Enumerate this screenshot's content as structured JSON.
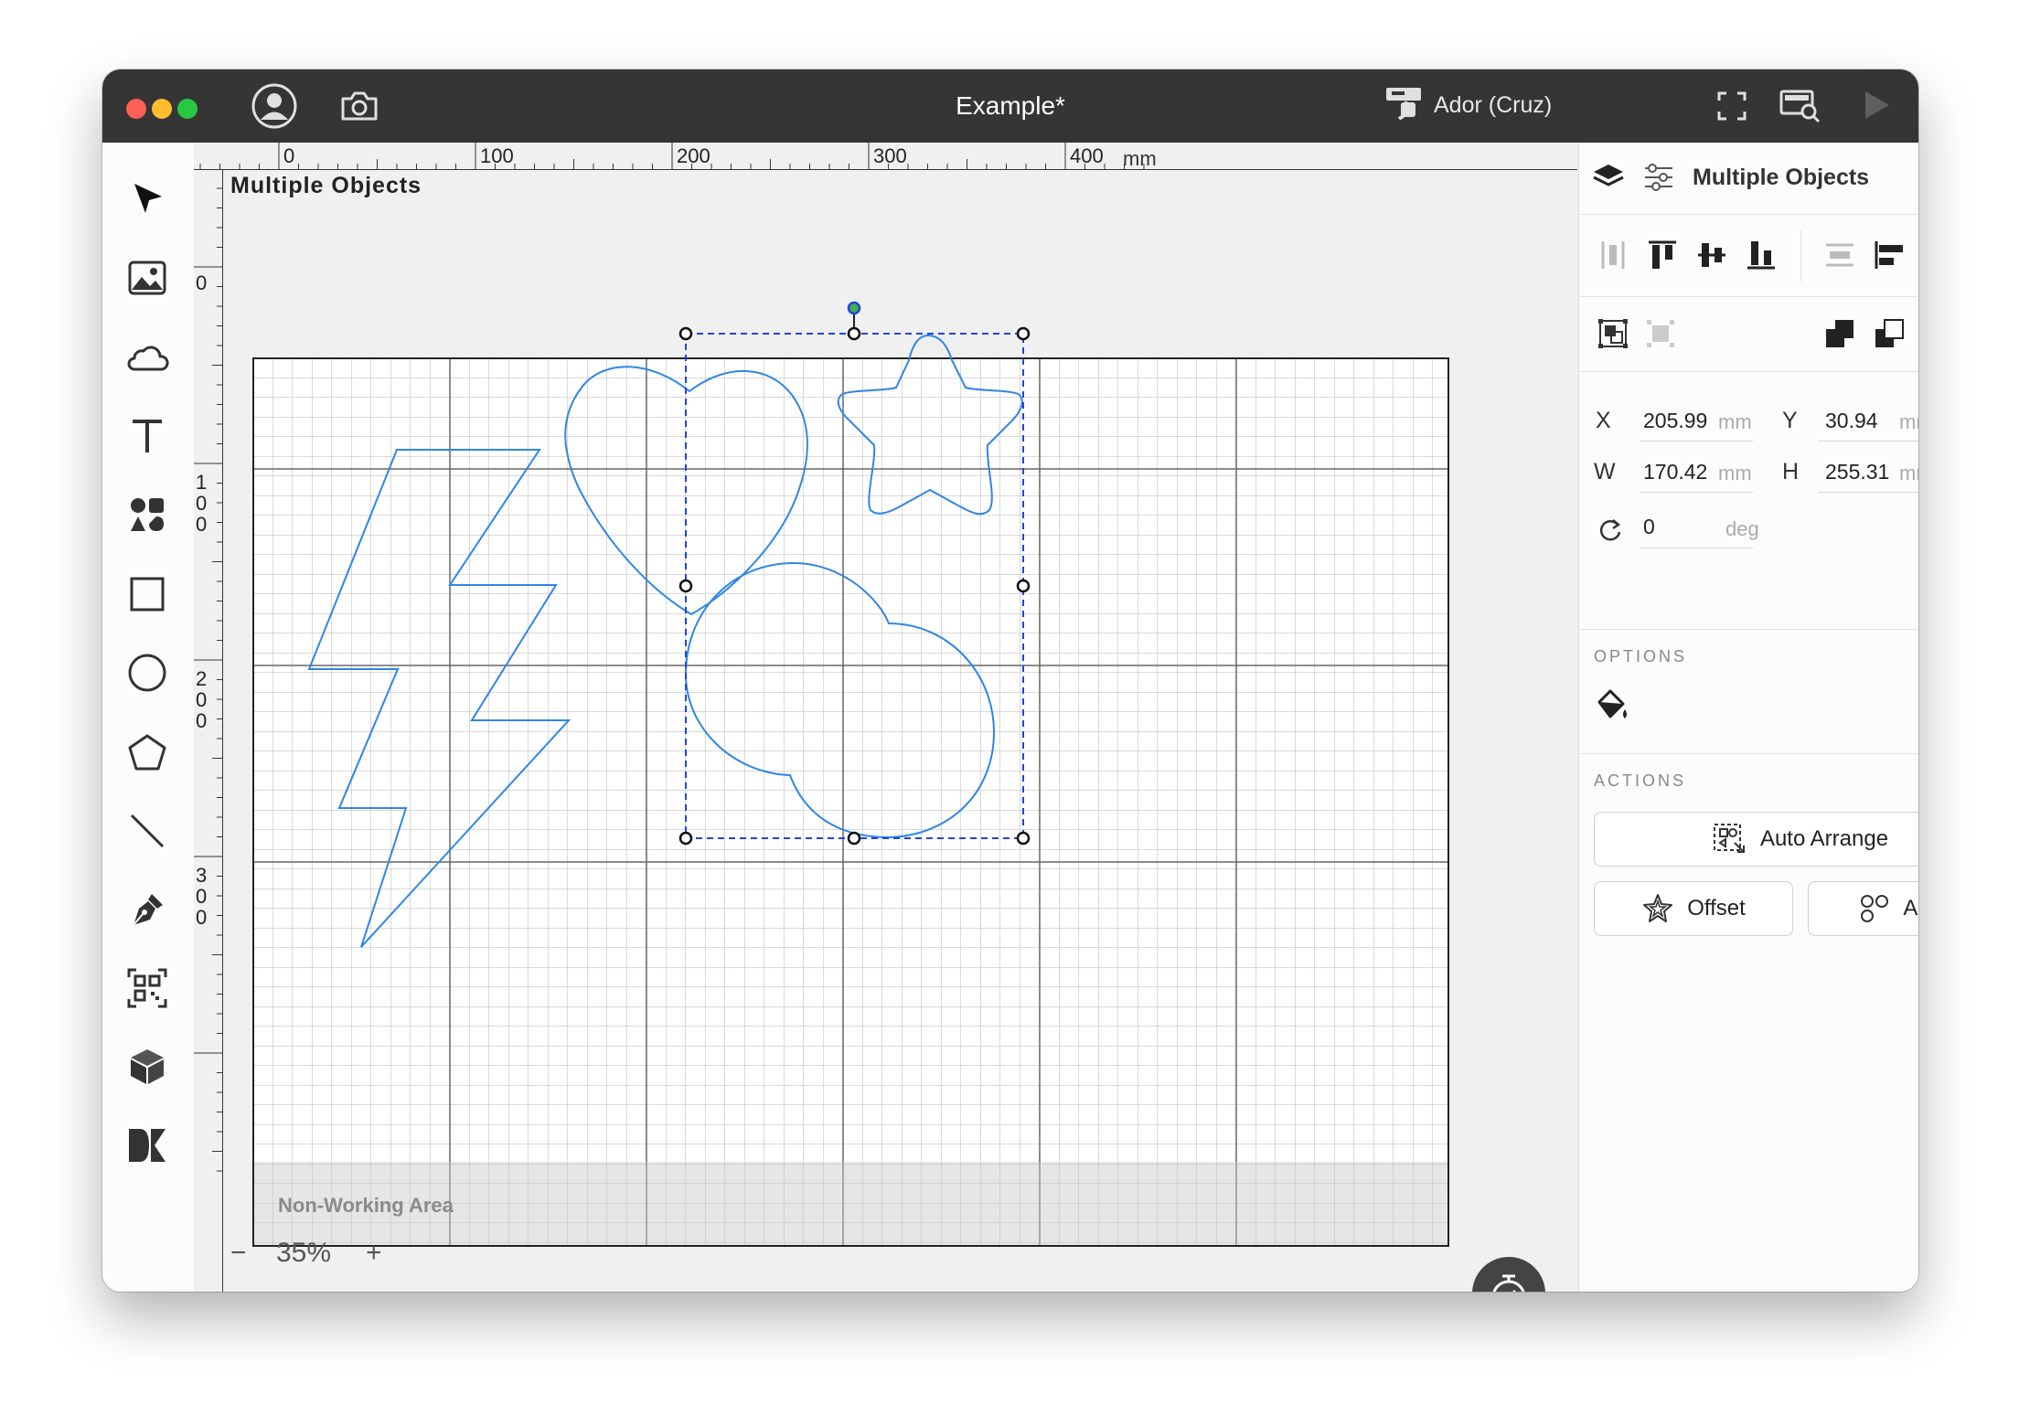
{
  "window": {
    "title": "Example*",
    "device_name": "Ador (Cruz)"
  },
  "toolbar": {
    "tools": [
      "select-tool",
      "image-tool",
      "cloud-tool",
      "text-tool",
      "elements-tool",
      "rectangle-tool",
      "ellipse-tool",
      "polygon-tool",
      "line-tool",
      "pen-tool",
      "qr-code-tool",
      "box-tool",
      "dxf-tool"
    ]
  },
  "ruler": {
    "unit": "mm",
    "h_labels": [
      "0",
      "100",
      "200",
      "300",
      "400"
    ],
    "v_labels": [
      [
        "0"
      ],
      [
        "1",
        "0",
        "0"
      ],
      [
        "2",
        "0",
        "0"
      ],
      [
        "3",
        "0",
        "0"
      ]
    ]
  },
  "canvas": {
    "selection_label": "Multiple Objects",
    "non_working_label": "Non-Working Area",
    "zoom_minus": "−",
    "zoom_value": "35%",
    "zoom_plus": "+",
    "shape_color": "#2f86e6",
    "selection_color": "#2244dd"
  },
  "panel": {
    "title": "Multiple Objects",
    "x": {
      "label": "X",
      "value": "205.99",
      "unit": "mm"
    },
    "y": {
      "label": "Y",
      "value": "30.94",
      "unit": "mm"
    },
    "w": {
      "label": "W",
      "value": "170.42",
      "unit": "mm"
    },
    "h": {
      "label": "H",
      "value": "255.31",
      "unit": "mm"
    },
    "rotation": {
      "value": "0",
      "unit": "deg"
    },
    "options_title": "OPTIONS",
    "actions_title": "ACTIONS",
    "auto_arrange": "Auto Arrange",
    "offset": "Offset",
    "array": "Array"
  }
}
